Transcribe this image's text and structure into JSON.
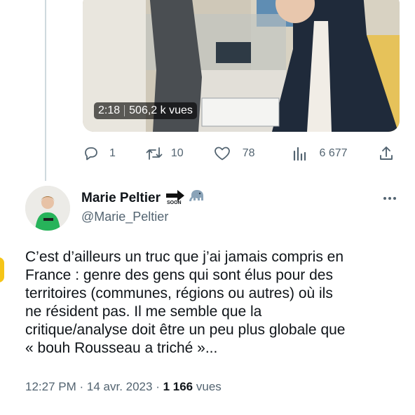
{
  "video": {
    "duration": "2:18",
    "views": "506,2 k vues"
  },
  "actions": {
    "replies": "1",
    "retweets": "10",
    "likes": "78",
    "views": "6 677"
  },
  "icons": {
    "reply": "reply-icon",
    "retweet": "retweet-icon",
    "like": "heart-icon",
    "views": "bar-chart-icon",
    "share": "share-icon",
    "more": "more-icon",
    "arrow": "arrow-right-icon",
    "mastodon": "elephant-icon"
  },
  "author": {
    "name": "Marie Peltier",
    "soon_label": "SOON",
    "handle": "@Marie_Peltier"
  },
  "tweet": {
    "text": "C’est d’ailleurs un truc que j’ai jamais compris en\nFrance : genre des gens qui sont élus pour des\nterritoires (communes, régions ou autres) où ils\nne résident pas. Il me semble que la\ncritique/analyse doit être un peu plus globale que\n« bouh Rousseau a triché »..."
  },
  "meta": {
    "time": "12:27 PM",
    "date": "14 avr. 2023",
    "views_count": "1 166",
    "views_label": "vues"
  },
  "colors": {
    "text": "#0f1419",
    "secondary": "#536471",
    "divider": "#cfd9de"
  }
}
